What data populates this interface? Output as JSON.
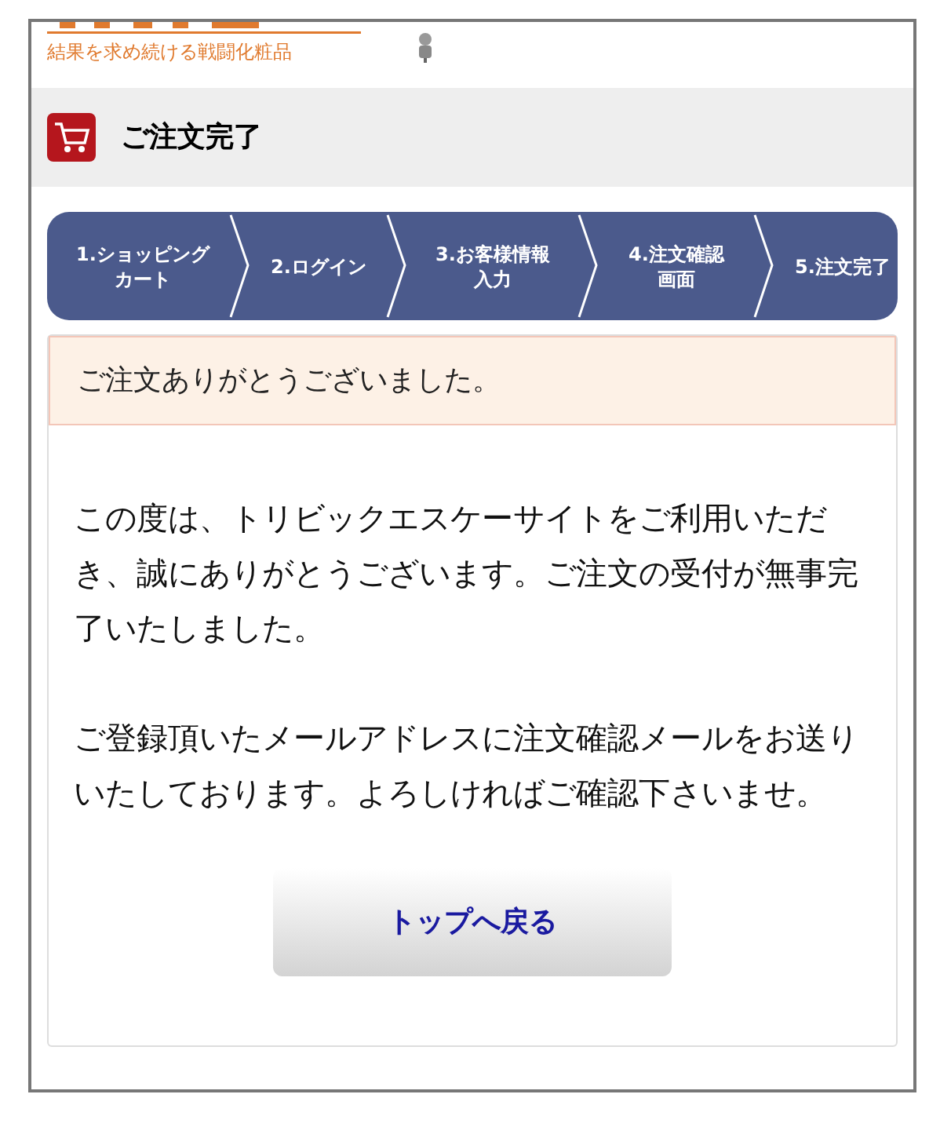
{
  "header": {
    "tagline": "結果を求め続ける戦闘化粧品"
  },
  "page_title": "ご注文完了",
  "steps": [
    {
      "lines": [
        "1.ショッピング",
        "カート"
      ]
    },
    {
      "lines": [
        "2.ログイン"
      ]
    },
    {
      "lines": [
        "3.お客様情報",
        "入力"
      ]
    },
    {
      "lines": [
        "4.注文確認",
        "画面"
      ]
    },
    {
      "lines": [
        "5.注文完了"
      ]
    }
  ],
  "message": {
    "heading": "ご注文ありがとうございました。",
    "paragraphs": [
      "この度は、トリビックエスケーサイトをご利用いただき、誠にありがとうございます。ご注文の受付が無事完了いたしました。",
      "ご登録頂いたメールアドレスに注文確認メールをお送りいたしております。よろしければご確認下さいませ。"
    ]
  },
  "button": "トップへ戻る"
}
